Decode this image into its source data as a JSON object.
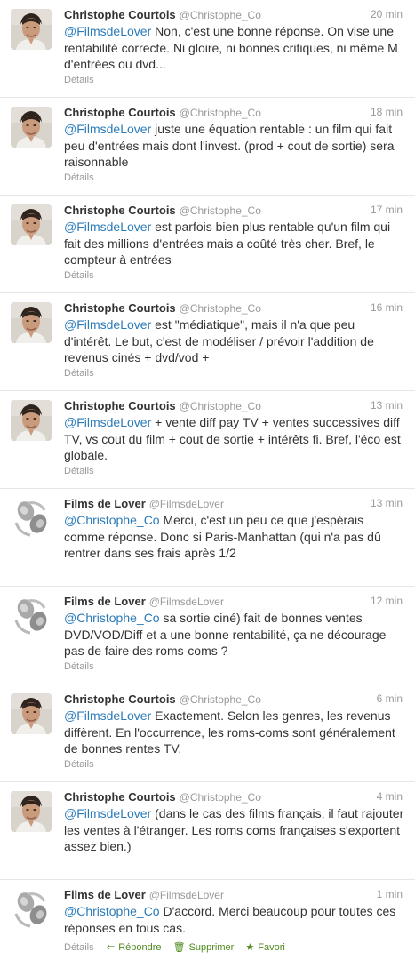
{
  "tweets": [
    {
      "name": "Christophe Courtois",
      "handle": "@Christophe_Co",
      "time": "20 min",
      "avatar": "christophe-avatar",
      "mention": "@FilmsdeLover",
      "text": " Non, c'est une bonne réponse. On vise une rentabilité correcte. Ni gloire, ni bonnes critiques, ni même M d'entrées ou dvd...",
      "details": "Détails"
    },
    {
      "name": "Christophe Courtois",
      "handle": "@Christophe_Co",
      "time": "18 min",
      "avatar": "christophe-avatar",
      "mention": "@FilmsdeLover",
      "text": " juste une équation rentable : un film qui fait peu d'entrées mais dont l'invest. (prod + cout de sortie) sera raisonnable",
      "details": "Détails"
    },
    {
      "name": "Christophe Courtois",
      "handle": "@Christophe_Co",
      "time": "17 min",
      "avatar": "christophe-avatar",
      "mention": "@FilmsdeLover",
      "text": " est parfois bien plus rentable qu'un film qui fait des millions d'entrées mais a coûté très cher. Bref, le compteur à entrées",
      "details": "Détails"
    },
    {
      "name": "Christophe Courtois",
      "handle": "@Christophe_Co",
      "time": "16 min",
      "avatar": "christophe-avatar",
      "mention": "@FilmsdeLover",
      "text": " est \"médiatique\", mais il n'a que peu d'intérêt. Le but, c'est de modéliser / prévoir l'addition de revenus cinés + dvd/vod +",
      "details": "Détails"
    },
    {
      "name": "Christophe Courtois",
      "handle": "@Christophe_Co",
      "time": "13 min",
      "avatar": "christophe-avatar",
      "mention": "@FilmsdeLover",
      "text": " + vente diff pay TV + ventes successives diff TV, vs cout du film + cout de sortie + intérêts fi. Bref, l'éco est globale.",
      "details": "Détails"
    },
    {
      "name": "Films de Lover",
      "handle": "@FilmsdeLover",
      "time": "13 min",
      "avatar": "filmsdelover-avatar",
      "mention": "@Christophe_Co",
      "text": " Merci, c'est un peu ce que j'espérais comme réponse. Donc si Paris-Manhattan (qui n'a pas dû rentrer dans ses frais après 1/2",
      "details": ""
    },
    {
      "name": "Films de Lover",
      "handle": "@FilmsdeLover",
      "time": "12 min",
      "avatar": "filmsdelover-avatar",
      "mention": "@Christophe_Co",
      "text": " sa sortie ciné) fait de bonnes ventes DVD/VOD/Diff et a une bonne rentabilité, ça ne décourage pas de faire des roms-coms ?",
      "details": "Détails"
    },
    {
      "name": "Christophe Courtois",
      "handle": "@Christophe_Co",
      "time": "6 min",
      "avatar": "christophe-avatar",
      "mention": "@FilmsdeLover",
      "text": " Exactement. Selon les genres, les revenus diffèrent. En l'occurrence, les roms-coms sont généralement de bonnes rentes TV.",
      "details": "Détails"
    },
    {
      "name": "Christophe Courtois",
      "handle": "@Christophe_Co",
      "time": "4 min",
      "avatar": "christophe-avatar",
      "mention": "@FilmsdeLover",
      "text": " (dans le cas des films français, il faut rajouter les ventes à l'étranger. Les roms coms françaises s'exportent assez bien.)",
      "details": ""
    },
    {
      "name": "Films de Lover",
      "handle": "@FilmsdeLover",
      "time": "1 min",
      "avatar": "filmsdelover-avatar",
      "mention": "@Christophe_Co",
      "text": " D'accord. Merci beaucoup pour toutes ces réponses en tous cas.",
      "details": "Détails"
    }
  ],
  "actions": {
    "reply": {
      "label": "Répondre",
      "icon": "reply-icon",
      "glyph": "⇐"
    },
    "delete": {
      "label": "Supprimer",
      "icon": "trash-icon",
      "glyph": "🗑"
    },
    "favorite": {
      "label": "Favori",
      "icon": "star-icon",
      "glyph": "★"
    }
  },
  "colors": {
    "mention": "#2b7bb9",
    "action": "#4f8b1f",
    "meta": "#999999",
    "divider": "#e6e6e6"
  }
}
